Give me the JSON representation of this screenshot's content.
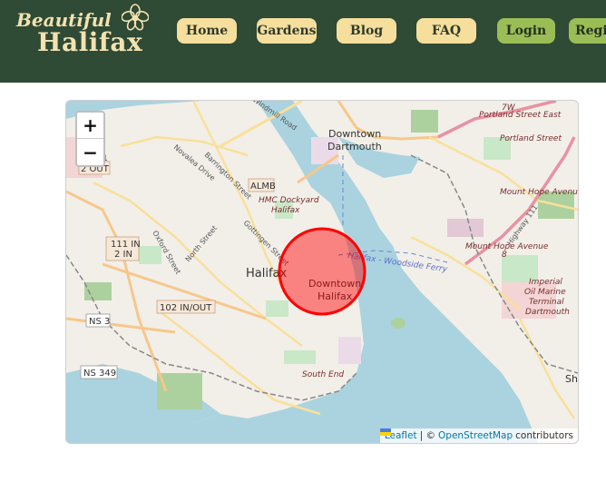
{
  "site": {
    "logo_top": "Beautiful",
    "logo_bottom": "Halifax"
  },
  "nav": {
    "home": "Home",
    "gardens": "Gardens",
    "blog": "Blog",
    "faq": "FAQ",
    "login": "Login",
    "register": "Regis"
  },
  "map": {
    "zoom_in": "+",
    "zoom_out": "−",
    "attribution": {
      "leaflet": "Leaflet",
      "separator": "| ©",
      "osm": "OpenStreetMap",
      "contributors": "contributors"
    },
    "labels": {
      "downtown_dartmouth_1": "Downtown",
      "downtown_dartmouth_2": "Dartmouth",
      "halifax": "Halifax",
      "downtown_halifax_1": "Downtown",
      "downtown_halifax_2": "Halifax",
      "portland_east": "Portland Street East",
      "portland_st": "Portland Street",
      "mount_hope_1": "Mount Hope Avenue",
      "mount_hope_2": "Mount Hope Avenue",
      "hmc_1": "HMC Dockyard",
      "hmc_2": "Halifax",
      "almb": "ALMB",
      "ferry": "Halifax - Woodside Ferry",
      "south_end": "South End",
      "imperial_1": "Imperial",
      "imperial_2": "Oil Marine",
      "imperial_3": "Terminal",
      "imperial_4": "Dartmouth",
      "out2": "2 OUT",
      "exit111_1": "111 IN",
      "exit111_2": "2 IN",
      "exit102": "102 IN/OUT",
      "ns3": "NS 3",
      "ns349": "NS 349",
      "barrington": "Barrington Street",
      "novalea": "Novalea Drive",
      "gottingen": "Gottingen Street",
      "oxford": "Oxford Street",
      "north": "North Street",
      "windmill": "Windmill Road",
      "highway": "Highway 111",
      "seven_w": "7W",
      "one": "1",
      "eight": "8",
      "sh": "Sh"
    },
    "marker_color": "#ff0000"
  }
}
